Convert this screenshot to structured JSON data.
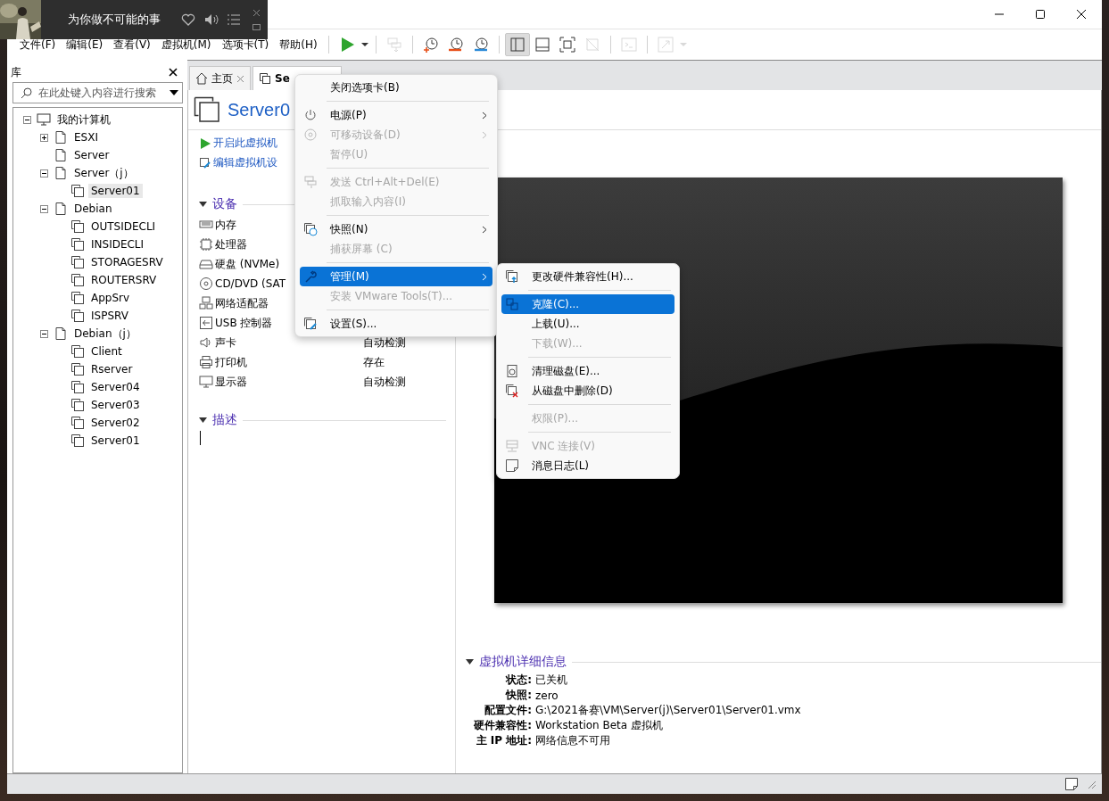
{
  "music_player": {
    "title": "为你做不可能的事",
    "liked": false
  },
  "menu_bar": [
    "文件(F)",
    "编辑(E)",
    "查看(V)",
    "虚拟机(M)",
    "选项卡(T)",
    "帮助(H)"
  ],
  "toolbar": [
    {
      "kind": "power-on",
      "disabled": false,
      "selected": false
    },
    {
      "kind": "power-menu",
      "disabled": false,
      "selected": false
    },
    {
      "kind": "separator"
    },
    {
      "kind": "send-keys",
      "disabled": true,
      "selected": false
    },
    {
      "kind": "separator"
    },
    {
      "kind": "take-snapshot",
      "disabled": false,
      "selected": false
    },
    {
      "kind": "revert-snapshot",
      "disabled": false,
      "selected": false
    },
    {
      "kind": "snapshot-manager",
      "disabled": false,
      "selected": false
    },
    {
      "kind": "separator"
    },
    {
      "kind": "library-view",
      "disabled": false,
      "selected": true
    },
    {
      "kind": "thumbnail-bar",
      "disabled": false,
      "selected": false
    },
    {
      "kind": "full-screen",
      "disabled": false,
      "selected": false
    },
    {
      "kind": "unity",
      "disabled": true,
      "selected": false
    },
    {
      "kind": "separator"
    },
    {
      "kind": "console-view",
      "disabled": true,
      "selected": false
    },
    {
      "kind": "separator"
    },
    {
      "kind": "stretch",
      "disabled": true,
      "selected": false
    },
    {
      "kind": "stretch-menu",
      "disabled": true,
      "selected": false
    }
  ],
  "library": {
    "title": "库",
    "search_placeholder": "在此处键入内容进行搜索",
    "tree": [
      {
        "label": "我的计算机",
        "kind": "computer",
        "expanded": true,
        "selected": false,
        "children": [
          {
            "label": "ESXI",
            "kind": "folder",
            "expanded": false,
            "selected": false
          },
          {
            "label": "Server",
            "kind": "folder",
            "selected": false
          },
          {
            "label": "Server（j）",
            "kind": "folder",
            "expanded": true,
            "selected": false,
            "children": [
              {
                "label": "Server01",
                "kind": "vm",
                "selected": true
              }
            ]
          },
          {
            "label": "Debian",
            "kind": "folder",
            "expanded": true,
            "selected": false,
            "children": [
              {
                "label": "OUTSIDECLI",
                "kind": "vm",
                "selected": false
              },
              {
                "label": "INSIDECLI",
                "kind": "vm",
                "selected": false
              },
              {
                "label": "STORAGESRV",
                "kind": "vm",
                "selected": false
              },
              {
                "label": "ROUTERSRV",
                "kind": "vm",
                "selected": false
              },
              {
                "label": "AppSrv",
                "kind": "vm",
                "selected": false
              },
              {
                "label": "ISPSRV",
                "kind": "vm",
                "selected": false
              }
            ]
          },
          {
            "label": "Debian（j）",
            "kind": "folder",
            "expanded": true,
            "selected": false,
            "children": [
              {
                "label": "Client",
                "kind": "vm",
                "selected": false
              },
              {
                "label": "Rserver",
                "kind": "vm",
                "selected": false
              },
              {
                "label": "Server04",
                "kind": "vm",
                "selected": false
              },
              {
                "label": "Server03",
                "kind": "vm",
                "selected": false
              },
              {
                "label": "Server02",
                "kind": "vm",
                "selected": false
              },
              {
                "label": "Server01",
                "kind": "vm",
                "selected": false
              }
            ]
          }
        ]
      }
    ]
  },
  "tabs": [
    {
      "label": "主页",
      "kind": "home",
      "selected": false
    },
    {
      "label": "Se",
      "kind": "vm",
      "selected": true
    }
  ],
  "vm": {
    "title": "Server0",
    "actions": [
      {
        "label": "开启此虚拟机",
        "kind": "power-on"
      },
      {
        "label": "编辑虚拟机设",
        "kind": "settings"
      }
    ],
    "devices_heading": "设备",
    "devices": [
      {
        "kind": "memory",
        "name": "内存"
      },
      {
        "kind": "cpu",
        "name": "处理器"
      },
      {
        "kind": "disk",
        "name": "硬盘 (NVMe)"
      },
      {
        "kind": "cd",
        "name": "CD/DVD (SAT"
      },
      {
        "kind": "network",
        "name": "网络适配器"
      },
      {
        "kind": "usb",
        "name": "USB 控制器"
      },
      {
        "kind": "sound",
        "name": "声卡",
        "value": "自动检测"
      },
      {
        "kind": "printer",
        "name": "打印机",
        "value": "存在"
      },
      {
        "kind": "display",
        "name": "显示器",
        "value": "自动检测"
      }
    ],
    "description_heading": "描述",
    "details_heading": "虚拟机详细信息",
    "details": [
      {
        "label": "状态:",
        "value": "已关机"
      },
      {
        "label": "快照:",
        "value": "zero"
      },
      {
        "label": "配置文件:",
        "value": "G:\\2021备赛\\VM\\Server(j)\\Server01\\Server01.vmx"
      },
      {
        "label": "硬件兼容性:",
        "value": "Workstation Beta 虚拟机"
      },
      {
        "label": "主 IP 地址:",
        "value": "网络信息不可用"
      }
    ]
  },
  "context_menu": [
    {
      "kind": "item",
      "label": "关闭选项卡(B)",
      "disabled": false,
      "selected": false,
      "submenu": false
    },
    {
      "kind": "separator"
    },
    {
      "kind": "item",
      "label": "电源(P)",
      "disabled": false,
      "selected": false,
      "submenu": true
    },
    {
      "kind": "item",
      "label": "可移动设备(D)",
      "disabled": true,
      "selected": false,
      "submenu": true
    },
    {
      "kind": "item",
      "label": "暂停(U)",
      "disabled": true,
      "selected": false,
      "submenu": false
    },
    {
      "kind": "separator"
    },
    {
      "kind": "item",
      "label": "发送 Ctrl+Alt+Del(E)",
      "disabled": true,
      "selected": false,
      "submenu": false
    },
    {
      "kind": "item",
      "label": "抓取输入内容(I)",
      "disabled": true,
      "selected": false,
      "submenu": false
    },
    {
      "kind": "separator"
    },
    {
      "kind": "item",
      "label": "快照(N)",
      "disabled": false,
      "selected": false,
      "submenu": true
    },
    {
      "kind": "item",
      "label": "捕获屏幕 (C)",
      "disabled": true,
      "selected": false,
      "submenu": false
    },
    {
      "kind": "separator"
    },
    {
      "kind": "item",
      "label": "管理(M)",
      "disabled": false,
      "selected": true,
      "submenu": true
    },
    {
      "kind": "item",
      "label": "安装 VMware Tools(T)...",
      "disabled": true,
      "selected": false,
      "submenu": false
    },
    {
      "kind": "separator"
    },
    {
      "kind": "item",
      "label": "设置(S)...",
      "disabled": false,
      "selected": false,
      "submenu": false
    }
  ],
  "submenu": [
    {
      "kind": "item",
      "label": "更改硬件兼容性(H)...",
      "disabled": false,
      "selected": false
    },
    {
      "kind": "separator"
    },
    {
      "kind": "item",
      "label": "克隆(C)...",
      "disabled": false,
      "selected": true
    },
    {
      "kind": "item",
      "label": "上载(U)...",
      "disabled": false,
      "selected": false
    },
    {
      "kind": "item",
      "label": "下载(W)...",
      "disabled": true,
      "selected": false
    },
    {
      "kind": "separator"
    },
    {
      "kind": "item",
      "label": "清理磁盘(E)...",
      "disabled": false,
      "selected": false
    },
    {
      "kind": "item",
      "label": "从磁盘中删除(D)",
      "disabled": false,
      "selected": false
    },
    {
      "kind": "separator"
    },
    {
      "kind": "item",
      "label": "权限(P)...",
      "disabled": true,
      "selected": false
    },
    {
      "kind": "separator"
    },
    {
      "kind": "item",
      "label": "VNC 连接(V)",
      "disabled": true,
      "selected": false
    },
    {
      "kind": "item",
      "label": "消息日志(L)",
      "disabled": false,
      "selected": false
    }
  ]
}
